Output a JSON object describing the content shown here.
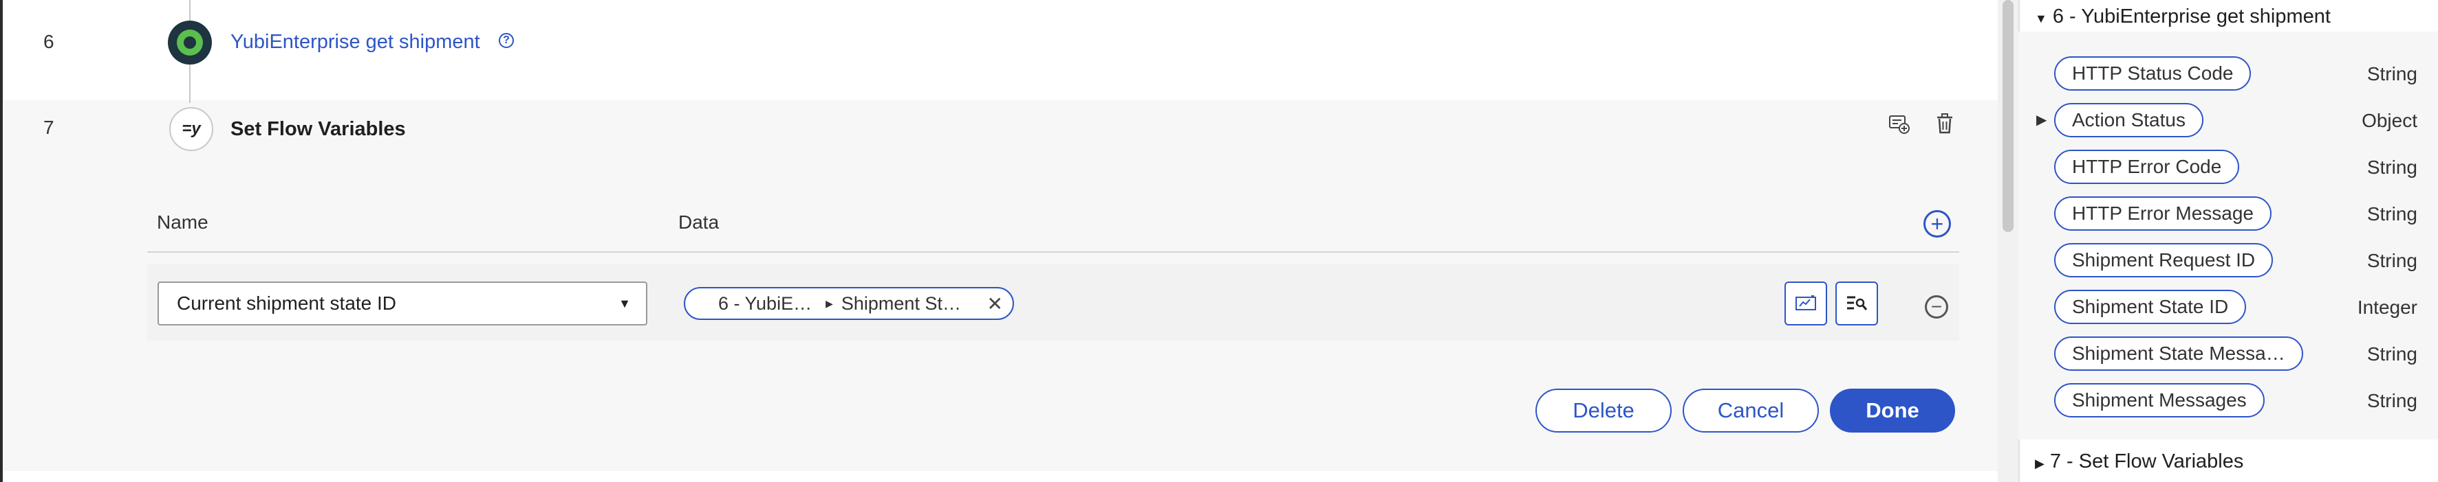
{
  "steps": [
    {
      "number": "6",
      "title": "YubiEnterprise get shipment",
      "icon": "yubikey-icon"
    },
    {
      "number": "7",
      "title": "Set Flow Variables",
      "icon_text": "=y"
    }
  ],
  "table": {
    "name_header": "Name",
    "data_header": "Data",
    "row": {
      "name_value": "Current shipment state ID",
      "data_part1": "6 - YubiE…",
      "data_part2": "Shipment St…"
    }
  },
  "buttons": {
    "delete": "Delete",
    "cancel": "Cancel",
    "done": "Done"
  },
  "right_panel": {
    "section1_title": "6 - YubiEnterprise get shipment",
    "section2_title": "7 - Set Flow Variables",
    "variables": [
      {
        "name": "HTTP Status Code",
        "type": "String",
        "expandable": false
      },
      {
        "name": "Action Status",
        "type": "Object",
        "expandable": true
      },
      {
        "name": "HTTP Error Code",
        "type": "String",
        "expandable": false
      },
      {
        "name": "HTTP Error Message",
        "type": "String",
        "expandable": false
      },
      {
        "name": "Shipment Request ID",
        "type": "String",
        "expandable": false
      },
      {
        "name": "Shipment State ID",
        "type": "Integer",
        "expandable": false
      },
      {
        "name": "Shipment State Messa…",
        "type": "String",
        "expandable": false
      },
      {
        "name": "Shipment Messages",
        "type": "String",
        "expandable": false
      }
    ]
  },
  "colors": {
    "accent": "#2d55c8",
    "yubico_green": "#5bbf4e",
    "row_bg": "#f7f7f7"
  }
}
